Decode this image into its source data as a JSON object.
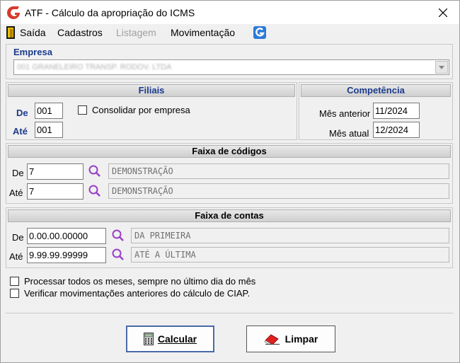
{
  "window": {
    "title": "ATF - Cálculo da apropriação do ICMS"
  },
  "menu": {
    "items": [
      "Saída",
      "Cadastros",
      "Listagem",
      "Movimentação"
    ]
  },
  "empresa": {
    "label": "Empresa",
    "value": "001 GRANELEIRO TRANSP. RODOV. LTDA"
  },
  "filiais": {
    "header": "Filiais",
    "de_label": "De",
    "de_value": "001",
    "ate_label": "Até",
    "ate_value": "001",
    "consolidar_label": "Consolidar por empresa"
  },
  "competencia": {
    "header": "Competência",
    "anterior_label": "Mês anterior",
    "anterior_value": "11/2024",
    "atual_label": "Mês atual",
    "atual_value": "12/2024"
  },
  "faixa_codigos": {
    "header": "Faixa de códigos",
    "de_label": "De",
    "de_value": "7",
    "de_desc": "DEMONSTRAÇÃO",
    "ate_label": "Até",
    "ate_value": "7",
    "ate_desc": "DEMONSTRAÇÃO"
  },
  "faixa_contas": {
    "header": "Faixa de contas",
    "de_label": "De",
    "de_value": "0.00.00.00000",
    "de_desc": "DA PRIMEIRA",
    "ate_label": "Até",
    "ate_value": "9.99.99.99999",
    "ate_desc": "ATÉ A ÚLTIMA"
  },
  "options": {
    "processar": "Processar todos os meses, sempre no último dia do mês",
    "verificar": "Verificar movimentações anteriores do cálculo de CIAP."
  },
  "buttons": {
    "calcular": "Calcular",
    "limpar": "Limpar"
  },
  "colors": {
    "label_blue": "#1a3a8c",
    "search_purple": "#9b3fc8"
  }
}
